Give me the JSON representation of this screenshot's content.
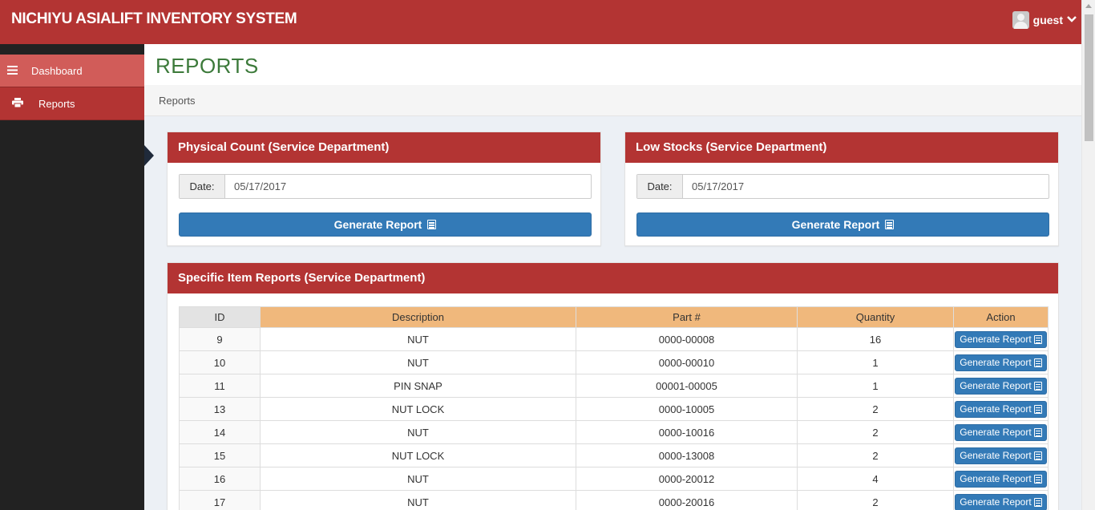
{
  "app": {
    "title": "NICHIYU ASIALIFT INVENTORY SYSTEM"
  },
  "user": {
    "name": "guest",
    "avatar_icon": "user-avatar-icon",
    "menu_icon": "chevron-down-icon"
  },
  "sidebar": {
    "items": [
      {
        "label": "Dashboard",
        "icon": "bars-icon",
        "active": true
      },
      {
        "label": "Reports",
        "icon": "print-icon",
        "active": false
      }
    ]
  },
  "page": {
    "title": "REPORTS",
    "breadcrumb": "Reports"
  },
  "physical_count": {
    "title": "Physical Count (Service Department)",
    "date_label": "Date:",
    "date_value": "05/17/2017",
    "button_label": "Generate Report"
  },
  "low_stocks": {
    "title": "Low Stocks (Service Department)",
    "date_label": "Date:",
    "date_value": "05/17/2017",
    "button_label": "Generate Report"
  },
  "specific_items": {
    "title": "Specific Item Reports (Service Department)",
    "columns": [
      "ID",
      "Description",
      "Part #",
      "Quantity",
      "Action"
    ],
    "action_label": "Generate Report",
    "rows": [
      {
        "id": "9",
        "description": "NUT",
        "part": "0000-00008",
        "quantity": "16"
      },
      {
        "id": "10",
        "description": "NUT",
        "part": "0000-00010",
        "quantity": "1"
      },
      {
        "id": "11",
        "description": "PIN SNAP",
        "part": "00001-00005",
        "quantity": "1"
      },
      {
        "id": "13",
        "description": "NUT LOCK",
        "part": "0000-10005",
        "quantity": "2"
      },
      {
        "id": "14",
        "description": "NUT",
        "part": "0000-10016",
        "quantity": "2"
      },
      {
        "id": "15",
        "description": "NUT LOCK",
        "part": "0000-13008",
        "quantity": "2"
      },
      {
        "id": "16",
        "description": "NUT",
        "part": "0000-20012",
        "quantity": "4"
      },
      {
        "id": "17",
        "description": "NUT",
        "part": "0000-20016",
        "quantity": "2"
      }
    ]
  },
  "colors": {
    "header": "#b33433",
    "sidebar_active": "#d15c59",
    "sidebar_bg": "#222222",
    "title_green": "#3c7a3a",
    "table_header": "#f0b87c",
    "button_blue": "#337ab7"
  }
}
